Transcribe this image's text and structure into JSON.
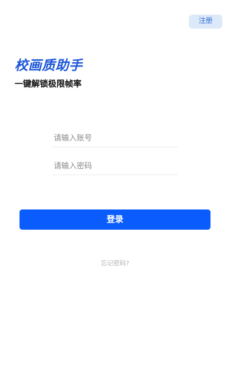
{
  "header": {
    "register_label": "注册"
  },
  "brand": {
    "title": "校画质助手",
    "subtitle": "一键解锁极限帧率",
    "accent_color": "#1b56d8"
  },
  "form": {
    "account_placeholder": "请输入账号",
    "account_value": "",
    "password_placeholder": "请输入密码",
    "password_value": "",
    "login_label": "登录",
    "login_color": "#0a5cfd",
    "forgot_label": "忘记密码?"
  }
}
